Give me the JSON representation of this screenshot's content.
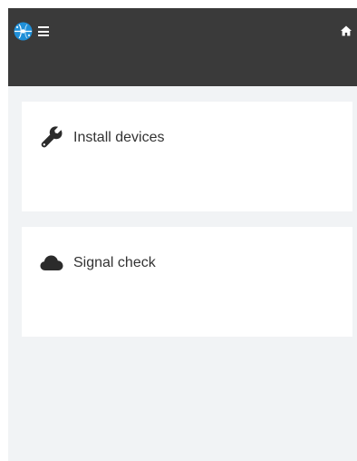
{
  "header": {
    "logo_icon": "globe-logo-icon",
    "menu_icon": "hamburger-icon",
    "home_icon": "home-icon",
    "colors": {
      "bar": "#3a3a3a",
      "logo": "#1f8fd8"
    }
  },
  "cards": [
    {
      "label": "Install devices",
      "icon": "wrench-icon"
    },
    {
      "label": "Signal check",
      "icon": "cloud-icon"
    }
  ],
  "colors": {
    "background": "#f1f3f5",
    "card": "#ffffff",
    "text": "#333333"
  }
}
